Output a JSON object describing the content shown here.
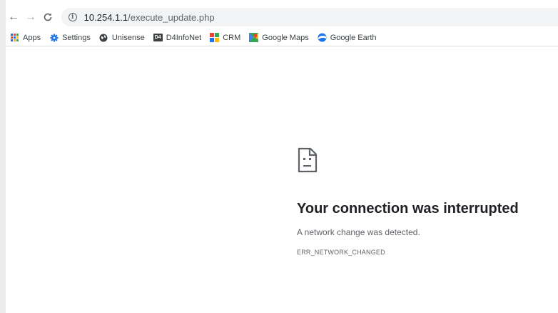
{
  "toolbar": {
    "back_icon": "←",
    "forward_icon": "→",
    "reload_icon": "C",
    "info_icon": "i",
    "url_host": "10.254.1.1",
    "url_path": "/execute_update.php"
  },
  "bookmarks": {
    "items": [
      {
        "label": "Apps",
        "icon": "apps-grid-icon"
      },
      {
        "label": "Settings",
        "icon": "gear-icon"
      },
      {
        "label": "Unisense",
        "icon": "globe-icon"
      },
      {
        "label": "D4InfoNet",
        "icon": "d4-logo-icon",
        "badge": "D4"
      },
      {
        "label": "CRM",
        "icon": "crm-grid-icon"
      },
      {
        "label": "Google Maps",
        "icon": "google-maps-icon"
      },
      {
        "label": "Google Earth",
        "icon": "google-earth-icon"
      }
    ]
  },
  "error": {
    "icon": "sad-page-icon",
    "title": "Your connection was interrupted",
    "description": "A network change was detected.",
    "code": "ERR_NETWORK_CHANGED"
  },
  "colors": {
    "gear_blue": "#1a73e8",
    "crm_red": "#ea4335",
    "crm_green": "#34a853",
    "crm_blue": "#1a73e8",
    "crm_yellow": "#fbbc04",
    "earth_blue": "#1a73e8",
    "text_primary": "#202124",
    "text_secondary": "#5f6368"
  }
}
